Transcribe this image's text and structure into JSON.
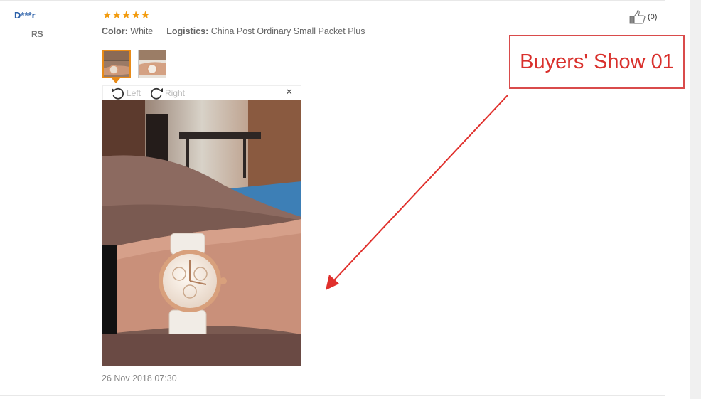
{
  "review": {
    "user_name": "D***r",
    "country": "RS",
    "rating": "★★★★★",
    "color_key": "Color:",
    "color_value": "White",
    "logistics_key": "Logistics:",
    "logistics_value": "China Post Ordinary Small Packet Plus",
    "helpful_count": "(0)",
    "date": "26 Nov 2018 07:30"
  },
  "viewer": {
    "rotate_left": "Left",
    "rotate_right": "Right",
    "close": "×"
  },
  "annotation": {
    "label": "Buyers' Show 01",
    "color": "#d9302c"
  },
  "colors": {
    "star": "#f29b0e",
    "username": "#2a5fa8",
    "thumb_active": "#e78a18"
  }
}
